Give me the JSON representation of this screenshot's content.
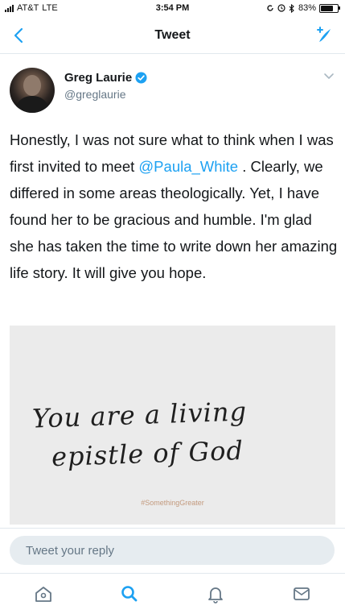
{
  "status_bar": {
    "carrier": "AT&T",
    "network": "LTE",
    "time": "3:54 PM",
    "battery": "83%",
    "battery_level": 0.83
  },
  "nav": {
    "title": "Tweet",
    "back_icon": "chevron-left-icon",
    "compose_icon": "compose-tweet-icon"
  },
  "tweet": {
    "author": {
      "name": "Greg Laurie",
      "handle": "@greglaurie",
      "verified": true
    },
    "text_before": "Honestly, I was not sure what to think when I was first invited to meet ",
    "mention": "@Paula_White",
    "text_after": " . Clearly, we differed in some areas theologically. Yet, I have found her to be gracious and humble. I'm glad she has taken the time to write down her amazing life story. It will give you hope.",
    "media": {
      "line1": "You are a living",
      "line2": "epistle of God",
      "hashtag": "#SomethingGreater"
    }
  },
  "reply": {
    "placeholder": "Tweet your reply"
  },
  "tabs": [
    {
      "icon": "home-icon"
    },
    {
      "icon": "search-icon",
      "active": true
    },
    {
      "icon": "bell-icon"
    },
    {
      "icon": "mail-icon"
    }
  ],
  "colors": {
    "accent": "#1da1f2",
    "text": "#14171a",
    "muted": "#657786"
  }
}
